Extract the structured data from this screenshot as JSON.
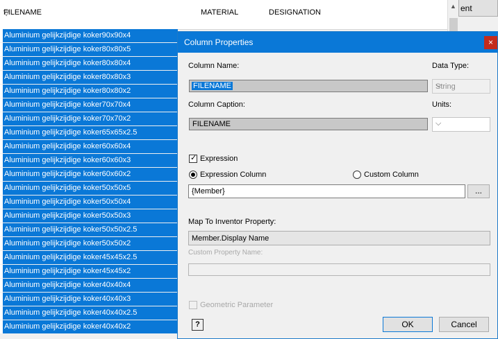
{
  "table": {
    "headers": [
      "FILENAME",
      "MATERIAL",
      "DESIGNATION"
    ],
    "rows": [
      "Aluminium gelijkzijdige koker90x90x4",
      "Aluminium gelijkzijdige koker80x80x5",
      "Aluminium gelijkzijdige koker80x80x4",
      "Aluminium gelijkzijdige koker80x80x3",
      "Aluminium gelijkzijdige koker80x80x2",
      "Aluminium gelijkzijdige koker70x70x4",
      "Aluminium gelijkzijdige koker70x70x2",
      "Aluminium gelijkzijdige koker65x65x2.5",
      "Aluminium gelijkzijdige koker60x60x4",
      "Aluminium gelijkzijdige koker60x60x3",
      "Aluminium gelijkzijdige koker60x60x2",
      "Aluminium gelijkzijdige koker50x50x5",
      "Aluminium gelijkzijdige koker50x50x4",
      "Aluminium gelijkzijdige koker50x50x3",
      "Aluminium gelijkzijdige koker50x50x2.5",
      "Aluminium gelijkzijdige koker50x50x2",
      "Aluminium gelijkzijdige koker45x45x2.5",
      "Aluminium gelijkzijdige koker45x45x2",
      "Aluminium gelijkzijdige koker40x40x4",
      "Aluminium gelijkzijdige koker40x40x3",
      "Aluminium gelijkzijdige koker40x40x2.5",
      "Aluminium gelijkzijdige koker40x40x2"
    ],
    "behind_button_label": "ent"
  },
  "dialog": {
    "title": "Column Properties",
    "close_label": "×",
    "column_name_label": "Column Name:",
    "column_name_value": "FILENAME",
    "data_type_label": "Data Type:",
    "data_type_value": "String",
    "column_caption_label": "Column Caption:",
    "column_caption_value": "FILENAME",
    "units_label": "Units:",
    "units_value": "",
    "expression_label": "Expression",
    "expression_checked": true,
    "expression_column_label": "Expression Column",
    "custom_column_label": "Custom Column",
    "expression_value": "{Member}",
    "browse_label": "...",
    "map_label": "Map To Inventor Property:",
    "map_value": "Member.Display Name",
    "custom_property_label": "Custom Property Name:",
    "custom_property_value": "",
    "geometric_label": "Geometric Parameter",
    "ok_label": "OK",
    "cancel_label": "Cancel",
    "help_label": "?"
  },
  "colors": {
    "selection_blue": "#0a78d7",
    "close_red": "#c42b1c",
    "dialog_bg": "#f0f0f0"
  }
}
